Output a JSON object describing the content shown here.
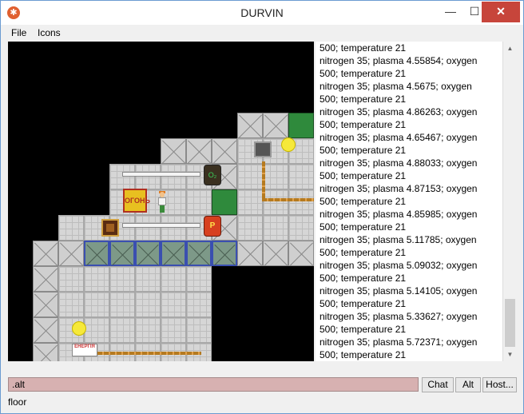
{
  "window": {
    "title": "DURVIN",
    "min_label": "—",
    "max_label": "☐",
    "close_label": "✕"
  },
  "menu": {
    "file": "File",
    "icons": "Icons"
  },
  "map": {
    "sign_text": "ОГОНЬ",
    "canister_dark_label": "O₂",
    "canister_red_label": "P",
    "energy_label": "ЕНЕРГІЯ"
  },
  "log": {
    "lines": [
      "500; temperature 21",
      "nitrogen 35; plasma 4.55854; oxygen",
      "500; temperature 21",
      "nitrogen 35; plasma 4.5675; oxygen",
      "500; temperature 21",
      "nitrogen 35; plasma 4.86263; oxygen",
      "500; temperature 21",
      "nitrogen 35; plasma 4.65467; oxygen",
      "500; temperature 21",
      "nitrogen 35; plasma 4.88033; oxygen",
      "500; temperature 21",
      "nitrogen 35; plasma 4.87153; oxygen",
      "500; temperature 21",
      "nitrogen 35; plasma 4.85985; oxygen",
      "500; temperature 21",
      "nitrogen 35; plasma 5.11785; oxygen",
      "500; temperature 21",
      "nitrogen 35; plasma 5.09032; oxygen",
      "500; temperature 21",
      "nitrogen 35; plasma 5.14105; oxygen",
      "500; temperature 21",
      "nitrogen 35; plasma 5.33627; oxygen",
      "500; temperature 21",
      "nitrogen 35; plasma 5.72371; oxygen",
      "500; temperature 21"
    ],
    "scrollbar_up": "▲",
    "scrollbar_down": "▼"
  },
  "input": {
    "value": ".alt"
  },
  "buttons": {
    "chat": "Chat",
    "alt": "Alt",
    "host": "Host..."
  },
  "status": {
    "text": "floor"
  }
}
